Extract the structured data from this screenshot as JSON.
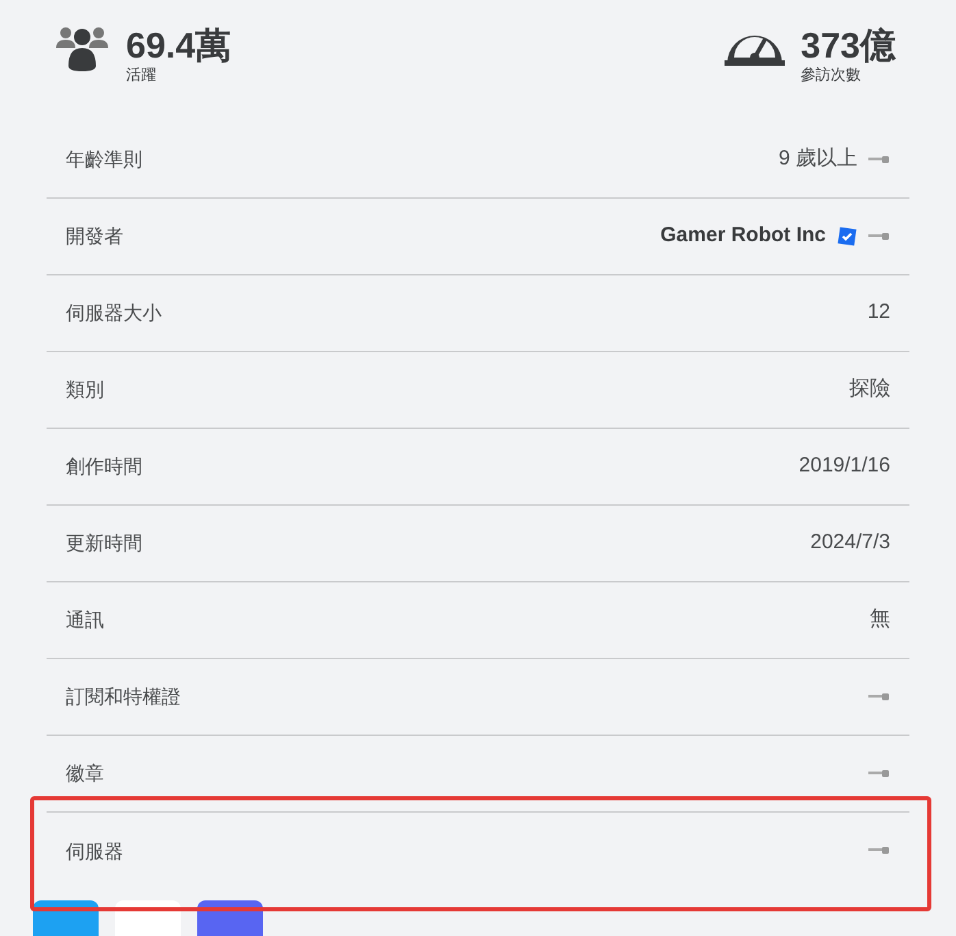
{
  "stats": [
    {
      "kind": "players",
      "value": "69.4萬",
      "label": "活躍"
    },
    {
      "kind": "visits",
      "value": "373億",
      "label": "參訪次數"
    }
  ],
  "details": [
    {
      "label": "年齡準則",
      "value": "9 歲以上",
      "verified": false,
      "link": true,
      "highlighted": false
    },
    {
      "label": "開發者",
      "value": "Gamer Robot Inc",
      "verified": true,
      "link": true,
      "highlighted": false
    },
    {
      "label": "伺服器大小",
      "value": "12",
      "verified": false,
      "link": false,
      "highlighted": false
    },
    {
      "label": "類別",
      "value": "探險",
      "verified": false,
      "link": false,
      "highlighted": false
    },
    {
      "label": "創作時間",
      "value": "2019/1/16",
      "verified": false,
      "link": false,
      "highlighted": false
    },
    {
      "label": "更新時間",
      "value": "2024/7/3",
      "verified": false,
      "link": false,
      "highlighted": false
    },
    {
      "label": "通訊",
      "value": "無",
      "verified": false,
      "link": false,
      "highlighted": false
    },
    {
      "label": "訂閱和特權證",
      "verified": false,
      "link": true,
      "highlighted": false
    },
    {
      "label": "徽章",
      "verified": false,
      "link": true,
      "highlighted": false
    },
    {
      "label": "伺服器",
      "verified": false,
      "link": true,
      "highlighted": true
    }
  ],
  "share_buttons": [
    {
      "color": "#1da1f2"
    },
    {
      "color": "#ffffff"
    },
    {
      "color": "#5865f2"
    }
  ]
}
